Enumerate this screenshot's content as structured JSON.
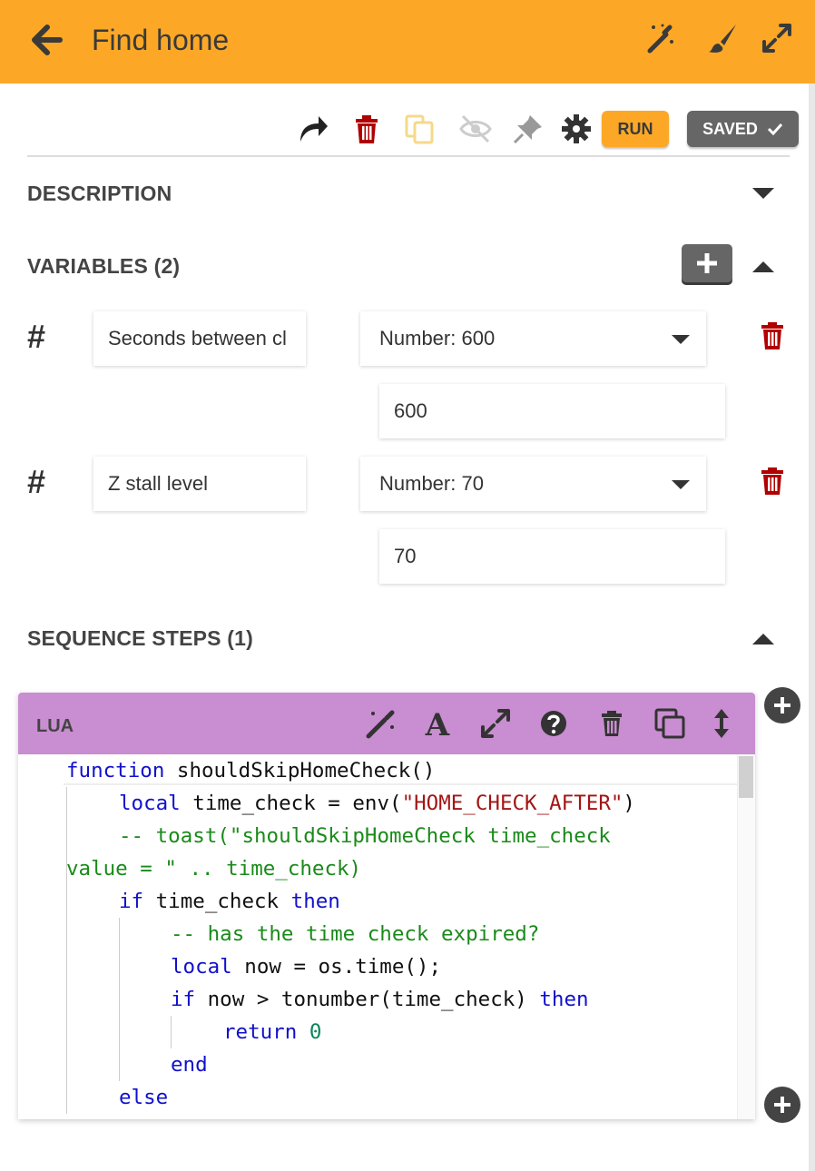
{
  "header": {
    "title": "Find home",
    "back_icon": "arrow-left-icon",
    "icons": [
      "magic-wand-icon",
      "paintbrush-icon",
      "expand-icon"
    ],
    "background": "#fca826"
  },
  "toolbar": {
    "icons": [
      "redo-icon",
      "trash-icon",
      "copy-icon",
      "eye-slash-icon",
      "pin-icon",
      "gear-icon"
    ],
    "run_label": "RUN",
    "saved_label": "SAVED"
  },
  "description": {
    "title": "DESCRIPTION"
  },
  "variables": {
    "title": "VARIABLES (2)",
    "items": [
      {
        "label": "Seconds between cl",
        "type_label": "Number: 600",
        "value": "600"
      },
      {
        "label": "Z stall level",
        "type_label": "Number: 70",
        "value": "70"
      }
    ]
  },
  "sequence": {
    "title": "SEQUENCE STEPS (1)",
    "step": {
      "label": "LUA",
      "icons": [
        "magic-wand-icon",
        "font-icon",
        "expand-icon",
        "question-circle-icon",
        "trash-icon",
        "clone-icon",
        "arrows-vertical-icon"
      ],
      "code_lines": [
        [
          {
            "t": "function",
            "c": "kw"
          },
          {
            "t": " shouldSkipHomeCheck()",
            "c": ""
          }
        ],
        [
          {
            "t": "local",
            "c": "kw"
          },
          {
            "t": " time_check = env(",
            "c": ""
          },
          {
            "t": "\"HOME_CHECK_AFTER\"",
            "c": "str"
          },
          {
            "t": ")",
            "c": ""
          }
        ],
        [
          {
            "t": "-- toast(\"shouldSkipHomeCheck time_check",
            "c": "cm"
          }
        ],
        [
          {
            "t": "value = \" .. time_check)",
            "c": "cm"
          }
        ],
        [
          {
            "t": "if",
            "c": "kw"
          },
          {
            "t": " time_check ",
            "c": ""
          },
          {
            "t": "then",
            "c": "kw"
          }
        ],
        [
          {
            "t": "-- has the time check expired?",
            "c": "cm"
          }
        ],
        [
          {
            "t": "local",
            "c": "kw"
          },
          {
            "t": " now = os.time();",
            "c": ""
          }
        ],
        [
          {
            "t": "if",
            "c": "kw"
          },
          {
            "t": " now > tonumber(time_check) ",
            "c": ""
          },
          {
            "t": "then",
            "c": "kw"
          }
        ],
        [
          {
            "t": "return",
            "c": "kw"
          },
          {
            "t": " ",
            "c": ""
          },
          {
            "t": "0",
            "c": "num"
          }
        ],
        [
          {
            "t": "end",
            "c": "kw"
          }
        ],
        [
          {
            "t": "else",
            "c": "kw"
          }
        ]
      ]
    }
  }
}
